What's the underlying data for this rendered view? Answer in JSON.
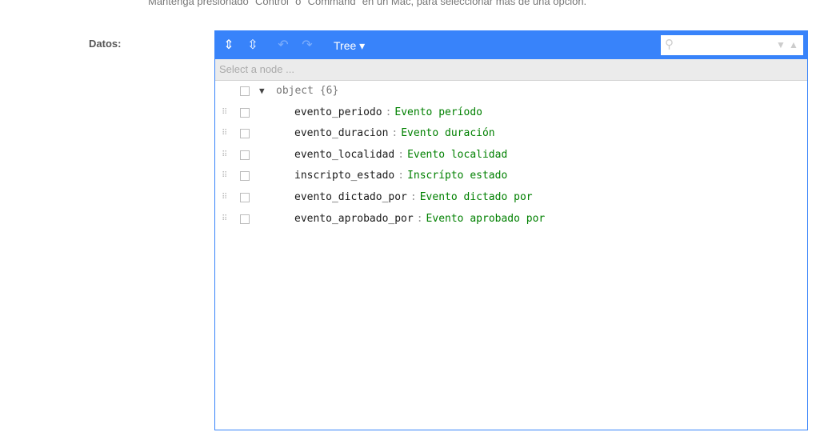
{
  "help_text": "Mantenga presionado \"Control\" o \"Command\" en un Mac, para seleccionar más de una opción.",
  "field_label": "Datos:",
  "editor": {
    "colors": {
      "accent": "#3883fa",
      "value": "#008000"
    },
    "menu": {
      "expand_icon": "expand-all-icon",
      "collapse_icon": "collapse-all-icon",
      "undo_icon": "undo-icon",
      "redo_icon": "redo-icon",
      "mode": "Tree ▾",
      "search_value": ""
    },
    "nav_placeholder": "Select a node ...",
    "root": "object {6}",
    "items": [
      {
        "key": "evento_periodo",
        "value": "Evento período"
      },
      {
        "key": "evento_duracion",
        "value": "Evento duración"
      },
      {
        "key": "evento_localidad",
        "value": "Evento localidad"
      },
      {
        "key": "inscripto_estado",
        "value": "Inscrípto estado"
      },
      {
        "key": "evento_dictado_por",
        "value": "Evento dictado por"
      },
      {
        "key": "evento_aprobado_por",
        "value": "Evento aprobado por"
      }
    ]
  }
}
